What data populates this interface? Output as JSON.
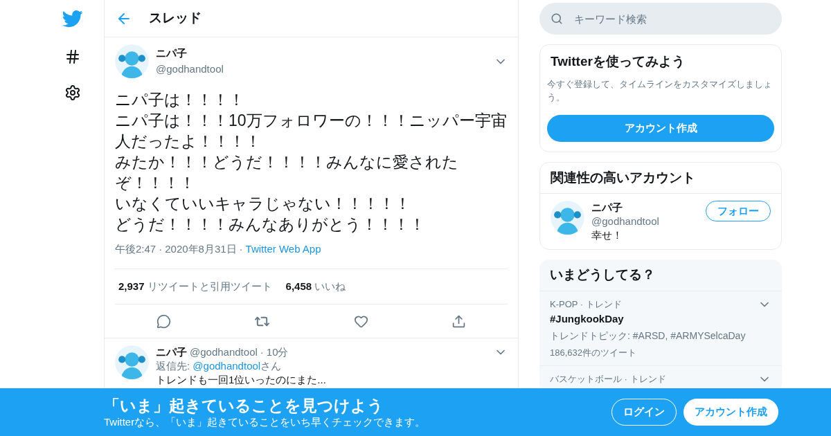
{
  "header": {
    "title": "スレッド"
  },
  "tweet": {
    "name": "ニパ子",
    "handle": "@godhandtool",
    "body": [
      "ニパ子は！！！！",
      "ニパ子は！！！10万フォロワーの！！！ニッパー宇宙人だったよ！！！！",
      "みたか！！！どうだ！！！！みんなに愛されたぞ！！！！",
      "いなくていいキャラじゃない！！！！！",
      "どうだ！！！！みんなありがとう！！！！"
    ],
    "separator": "·",
    "time": "午後2:47",
    "date": "2020年8月31日",
    "source": "Twitter Web App",
    "retweets": "2,937",
    "retweets_label": "リツイートと引用ツイート",
    "likes": "6,458",
    "likes_label": "いいね"
  },
  "reply": {
    "name": "ニパ子",
    "handle": "@godhandtool",
    "separator": "·",
    "age": "10分",
    "reply_to_label": "返信先: ",
    "reply_to": "@godhandtool",
    "reply_to_suffix": "さん",
    "text": "トレンドも一回1位いったのにまた..."
  },
  "search": {
    "placeholder": "キーワード検索"
  },
  "signup_card": {
    "title": "Twitterを使ってみよう",
    "text": "今すぐ登録して、タイムラインをカスタマイズしましょう。",
    "button": "アカウント作成"
  },
  "accounts_card": {
    "title": "関連性の高いアカウント",
    "accounts": [
      {
        "name": "ニパ子",
        "handle": "@godhandtool",
        "bio": "幸せ！",
        "button": "フォロー"
      }
    ]
  },
  "trends_card": {
    "title": "いまどうしてる？",
    "trends": [
      {
        "context": "K-POP · トレンド",
        "name": "#JungkookDay",
        "topics": "トレンドトピック: #ARSD, #ARMYSelcaDay",
        "count": "186,632件のツイート"
      },
      {
        "context": "バスケットボール · トレンド"
      }
    ]
  },
  "banner": {
    "title": "「いま」起きていることを見つけよう",
    "subtitle": "Twitterなら、「いま」起きていることをいち早くチェックできます。",
    "login": "ログイン",
    "signup": "アカウント作成"
  }
}
